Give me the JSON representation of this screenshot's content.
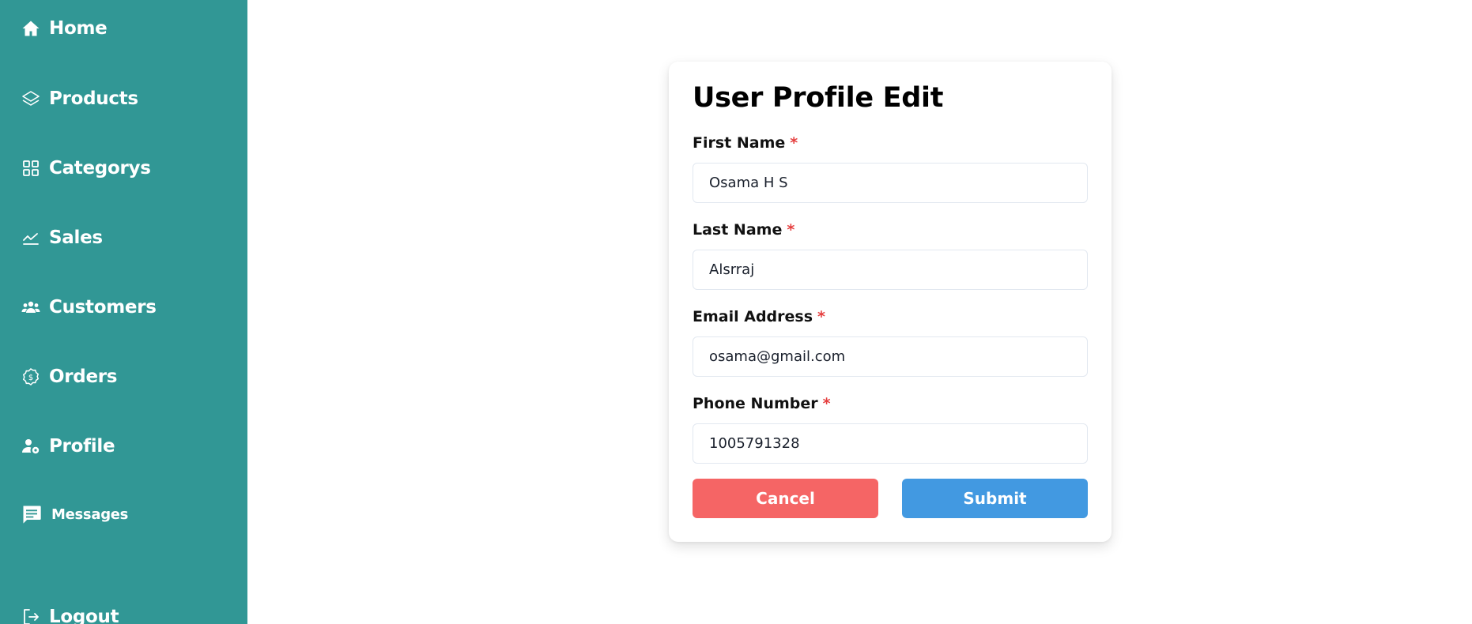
{
  "sidebar": {
    "items": [
      {
        "label": "Home",
        "icon": "home-icon"
      },
      {
        "label": "Products",
        "icon": "layers-icon"
      },
      {
        "label": "Categorys",
        "icon": "grid-icon"
      },
      {
        "label": "Sales",
        "icon": "chart-line-icon"
      },
      {
        "label": "Customers",
        "icon": "users-icon"
      },
      {
        "label": "Orders",
        "icon": "badge-dollar-icon"
      },
      {
        "label": "Profile",
        "icon": "user-gear-icon"
      },
      {
        "label": "Messages",
        "icon": "message-icon"
      },
      {
        "label": "Logout",
        "icon": "logout-icon"
      }
    ]
  },
  "form": {
    "title": "User Profile Edit",
    "required_mark": "*",
    "fields": [
      {
        "label": "First Name",
        "value": "Osama H S"
      },
      {
        "label": "Last Name",
        "value": "Alsrraj"
      },
      {
        "label": "Email Address",
        "value": "osama@gmail.com"
      },
      {
        "label": "Phone Number",
        "value": "1005791328"
      }
    ],
    "cancel_label": "Cancel",
    "submit_label": "Submit"
  },
  "colors": {
    "sidebar_bg": "#319795",
    "cancel": "#f56565",
    "submit": "#4299e1",
    "required": "#e53e3e"
  }
}
